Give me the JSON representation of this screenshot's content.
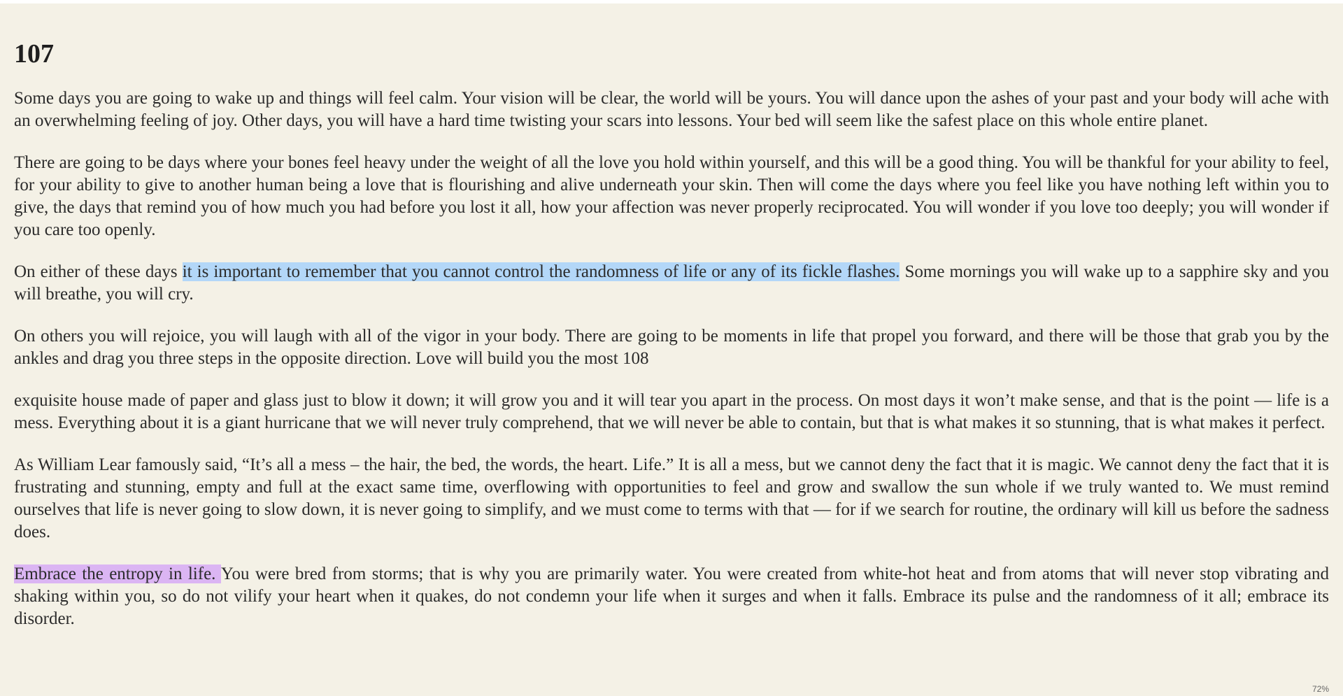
{
  "page": {
    "number": "107"
  },
  "paragraphs": [
    {
      "text": "Some days you are going to wake up and things will feel calm. Your vision will be clear, the world will be yours. You will dance upon the ashes of your past and your body will ache with an overwhelming feeling of joy. Other days, you will have a hard time twisting your scars into lessons. Your bed will seem like the safest place on this whole entire planet."
    },
    {
      "text": "There are going to be days where your bones feel heavy under the weight of all the love you hold within yourself, and this will be a good thing. You will be thankful for your ability to feel, for your ability to give to another human being a love that is flourishing and alive underneath your skin. Then will come the days where you feel like you have nothing left within you to give, the days that remind you of how much you had before you lost it all, how your affection was never properly reciprocated. You will wonder if you love too deeply; you will wonder if you care too openly."
    },
    {
      "before": "On either of these days ",
      "highlight": "it is important to remember that you cannot control the randomness of life or any of its fickle flashes.",
      "after": " Some mornings you will wake up to a sapphire sky and you will breathe, you will cry."
    },
    {
      "text": "On others you will rejoice, you will laugh with all of the vigor in your body. There are going to be moments in life that propel you forward, and there will be those that grab you by the ankles and drag you three steps in the opposite direction. Love will build you the most 108"
    },
    {
      "text": "exquisite house made of paper and glass just to blow it down; it will grow you and it will tear you apart in the process. On most days it won’t make sense, and that is the point — life is a mess. Everything about it is a giant hurricane that we will never truly comprehend, that we will never be able to contain, but that is what makes it so stunning, that is what makes it perfect."
    },
    {
      "text": "As William Lear famously said, “It’s all a mess – the hair, the bed, the words, the heart. Life.” It is all a mess, but we cannot deny the fact that it is magic. We cannot deny the fact that it is frustrating and stunning, empty and full at the exact same time, overflowing with opportunities to feel and grow and swallow the sun whole if we truly wanted to. We must remind ourselves that life is never going to slow down, it is never going to simplify, and we must come to terms with that — for if we search for routine, the ordinary will kill us before the sadness does."
    },
    {
      "highlight": "Embrace the entropy in life. ",
      "after": "You were bred from storms; that is why you are primarily water. You were created from white-hot heat and from atoms that will never stop vibrating and shaking within you, so do not vilify your heart when it quakes, do not condemn your life when it surges and when it falls. Embrace its pulse and the randomness of it all; embrace its disorder."
    }
  ],
  "highlight_colors": {
    "blue": "#b3d7f8",
    "purple": "#dbb5f3"
  },
  "background_color": "#f4f1e6",
  "zoom": {
    "label": "72%"
  }
}
